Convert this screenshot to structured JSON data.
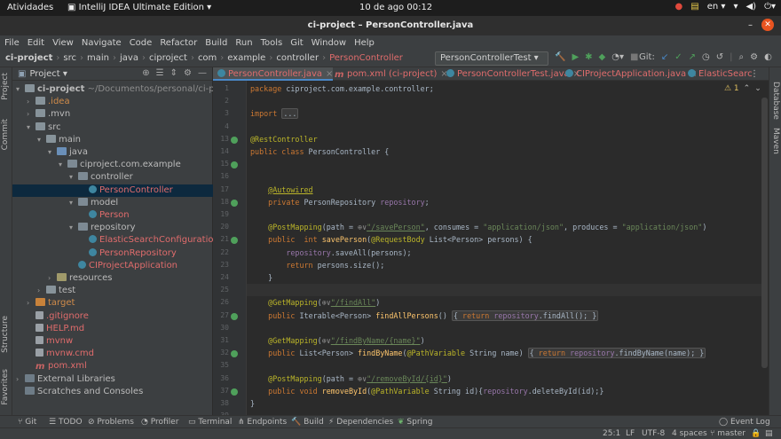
{
  "gnome": {
    "activities": "Atividades",
    "app": "IntelliJ IDEA Ultimate Edition ▾",
    "clock": "10 de ago  00:12",
    "lang": "en ▾"
  },
  "window": {
    "title": "ci-project – PersonController.java"
  },
  "menu": [
    "File",
    "Edit",
    "View",
    "Navigate",
    "Code",
    "Refactor",
    "Build",
    "Run",
    "Tools",
    "Git",
    "Window",
    "Help"
  ],
  "breadcrumb": [
    "ci-project",
    "src",
    "main",
    "java",
    "ciproject",
    "com",
    "example",
    "controller",
    "PersonController"
  ],
  "toolbar": {
    "run_config": "PersonControllerTest ▾",
    "git_label": "Git:"
  },
  "project_panel": {
    "title": "Project ▾",
    "items": [
      {
        "indent": 0,
        "arrow": "▾",
        "icon": "folder",
        "label": "ci-project",
        "suffix": " ~/Documentos/personal/ci-project",
        "color": "bold"
      },
      {
        "indent": 1,
        "arrow": "›",
        "icon": "folder",
        "label": ".idea",
        "color": "orange"
      },
      {
        "indent": 1,
        "arrow": "›",
        "icon": "folder",
        "label": ".mvn",
        "color": ""
      },
      {
        "indent": 1,
        "arrow": "▾",
        "icon": "folder",
        "label": "src",
        "color": ""
      },
      {
        "indent": 2,
        "arrow": "▾",
        "icon": "folder",
        "label": "main",
        "color": ""
      },
      {
        "indent": 3,
        "arrow": "▾",
        "icon": "folder-src",
        "label": "java",
        "color": ""
      },
      {
        "indent": 4,
        "arrow": "▾",
        "icon": "pkg",
        "label": "ciproject.com.example",
        "color": ""
      },
      {
        "indent": 5,
        "arrow": "▾",
        "icon": "pkg",
        "label": "controller",
        "color": ""
      },
      {
        "indent": 6,
        "arrow": "",
        "icon": "class",
        "label": "PersonController",
        "color": "red",
        "selected": true
      },
      {
        "indent": 5,
        "arrow": "▾",
        "icon": "pkg",
        "label": "model",
        "color": ""
      },
      {
        "indent": 6,
        "arrow": "",
        "icon": "class",
        "label": "Person",
        "color": "red"
      },
      {
        "indent": 5,
        "arrow": "▾",
        "icon": "pkg",
        "label": "repository",
        "color": ""
      },
      {
        "indent": 6,
        "arrow": "",
        "icon": "class",
        "label": "ElasticSearchConfiguration",
        "color": "red"
      },
      {
        "indent": 6,
        "arrow": "",
        "icon": "class",
        "label": "PersonRepository",
        "color": "red"
      },
      {
        "indent": 5,
        "arrow": "",
        "icon": "class",
        "label": "CIProjectApplication",
        "color": "red"
      },
      {
        "indent": 3,
        "arrow": "›",
        "icon": "folder-res",
        "label": "resources",
        "color": ""
      },
      {
        "indent": 2,
        "arrow": "›",
        "icon": "folder",
        "label": "test",
        "color": ""
      },
      {
        "indent": 1,
        "arrow": "›",
        "icon": "folder-target",
        "label": "target",
        "color": "orange"
      },
      {
        "indent": 1,
        "arrow": "",
        "icon": "file",
        "label": ".gitignore",
        "color": "red"
      },
      {
        "indent": 1,
        "arrow": "",
        "icon": "file",
        "label": "HELP.md",
        "color": "red"
      },
      {
        "indent": 1,
        "arrow": "",
        "icon": "file",
        "label": "mvnw",
        "color": "red"
      },
      {
        "indent": 1,
        "arrow": "",
        "icon": "file",
        "label": "mvnw.cmd",
        "color": "red"
      },
      {
        "indent": 1,
        "arrow": "",
        "icon": "maven",
        "label": "pom.xml",
        "color": "red"
      },
      {
        "indent": 0,
        "arrow": "›",
        "icon": "lib",
        "label": "External Libraries",
        "color": ""
      },
      {
        "indent": 0,
        "arrow": "",
        "icon": "lib",
        "label": "Scratches and Consoles",
        "color": ""
      }
    ]
  },
  "tabs": [
    {
      "label": "PersonController.java",
      "active": true,
      "color": "red"
    },
    {
      "label": "pom.xml (ci-project)",
      "active": false,
      "color": "red"
    },
    {
      "label": "PersonControllerTest.java",
      "active": false,
      "color": "red"
    },
    {
      "label": "CIProjectApplication.java",
      "active": false,
      "color": "red"
    },
    {
      "label": "ElasticSearc",
      "active": false,
      "color": "red"
    }
  ],
  "editor": {
    "warning": "⚠ 1",
    "current_line": 25,
    "lines": [
      {
        "n": 1,
        "html": "<span class='kw'>package</span> ciproject.com.example.controller;"
      },
      {
        "n": 2,
        "html": ""
      },
      {
        "n": 3,
        "html": "<span class='kw'>import</span> <span class='fold'>...</span>"
      },
      {
        "n": 4,
        "html": ""
      },
      {
        "n": 13,
        "html": "<span class='an'>@RestController</span>",
        "icon": true
      },
      {
        "n": 14,
        "html": "<span class='kw'>public class</span> PersonController {"
      },
      {
        "n": 15,
        "html": "",
        "icon": true
      },
      {
        "n": 16,
        "html": ""
      },
      {
        "n": 17,
        "html": "    <span class='an' style='text-decoration:underline'>@Autowired</span>"
      },
      {
        "n": 18,
        "html": "    <span class='kw'>private</span> PersonRepository <span class='fld'>repository</span>;",
        "icon": true
      },
      {
        "n": 19,
        "html": ""
      },
      {
        "n": 20,
        "html": "    <span class='an'>@PostMapping</span>(path = <span class='gray'>⊕∨</span><span class='url'>\"/savePerson\"</span>, consumes = <span class='st'>\"application/json\"</span>, produces = <span class='st'>\"application/json\"</span>)"
      },
      {
        "n": 21,
        "html": "    <span class='kw'>public  int</span> <span class='fn'>savePerson</span>(<span class='an'>@RequestBody</span> List&lt;Person&gt; persons) {",
        "icon": true
      },
      {
        "n": 22,
        "html": "        <span class='fld'>repository</span>.saveAll(persons);"
      },
      {
        "n": 23,
        "html": "        <span class='kw'>return</span> persons.size();"
      },
      {
        "n": 24,
        "html": "    }"
      },
      {
        "n": 25,
        "html": ""
      },
      {
        "n": 26,
        "html": "    <span class='an'>@GetMapping</span>(<span class='gray'>⊕∨</span><span class='url'>\"/findAll\"</span>)"
      },
      {
        "n": 27,
        "html": "    <span class='kw'>public</span> Iterable&lt;Person&gt; <span class='fn'>findAllPersons</span>() <span class='fold'>{ <span class='kw'>return</span> <span class='fld'>repository</span>.findAll(); }</span>",
        "icon": true
      },
      {
        "n": 30,
        "html": ""
      },
      {
        "n": 31,
        "html": "    <span class='an'>@GetMapping</span>(<span class='gray'>⊕∨</span><span class='url'>\"/findByName/{name}\"</span>)"
      },
      {
        "n": 32,
        "html": "    <span class='kw'>public</span> List&lt;Person&gt; <span class='fn'>findByName</span>(<span class='an'>@PathVariable</span> String name) <span class='fold'>{ <span class='kw'>return</span> <span class='fld'>repository</span>.findByName(name); }</span>",
        "icon": true
      },
      {
        "n": 35,
        "html": ""
      },
      {
        "n": 36,
        "html": "    <span class='an'>@PostMapping</span>(path = <span class='gray'>⊕∨</span><span class='url'>\"/removeById/{id}\"</span>)"
      },
      {
        "n": 37,
        "html": "    <span class='kw'>public void</span> <span class='fn'>removeById</span>(<span class='an'>@PathVariable</span> String id){<span class='fld'>repository</span>.deleteById(id);}",
        "icon": true
      },
      {
        "n": 38,
        "html": "}"
      },
      {
        "n": 39,
        "html": ""
      }
    ]
  },
  "left_stripe": [
    "Project",
    "Commit",
    "Structure",
    "Favorites"
  ],
  "right_stripe": [
    "Database",
    "Maven"
  ],
  "bottom_tools": [
    "Git",
    "TODO",
    "Problems",
    "Profiler",
    "Terminal",
    "Endpoints",
    "Build",
    "Dependencies",
    "Spring",
    "Event Log"
  ],
  "status": {
    "pos": "25:1",
    "eol": "LF",
    "enc": "UTF-8",
    "indent": "4 spaces",
    "branch": "master"
  },
  "colors": {
    "selection": "#0d293e",
    "accent": "#4a88c7",
    "keyword": "#cc7832",
    "annotation": "#bbb529",
    "string": "#6a8759"
  }
}
